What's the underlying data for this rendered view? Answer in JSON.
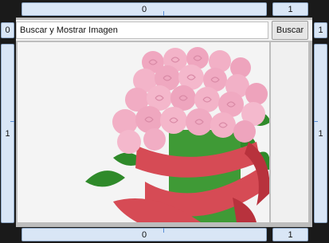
{
  "spinners": {
    "top_main": "0",
    "top_right": "1",
    "left_top": "0",
    "right_top": "1",
    "left_mid": "1",
    "right_mid": "1",
    "bottom_main": "0",
    "bottom_right": "1"
  },
  "search": {
    "value": "Buscar y Mostrar Imagen",
    "button_label": "Buscar"
  },
  "colors": {
    "spinner_bg": "#d9e6f6",
    "spinner_border": "#8fa9c8",
    "tick": "#5b8fd6",
    "background": "#1a1a1a"
  },
  "image": {
    "icon": "pink-roses-bouquet-image"
  }
}
